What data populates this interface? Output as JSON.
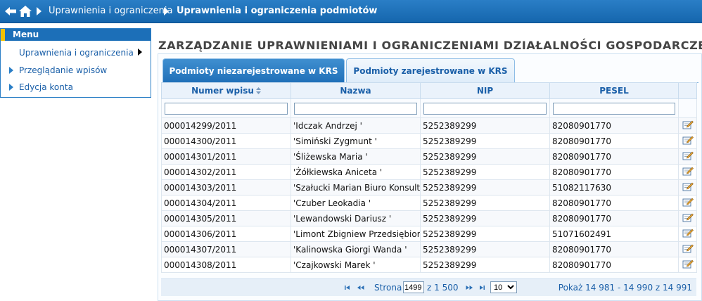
{
  "breadcrumb": {
    "item1": "Uprawnienia i ograniczenia",
    "item2": "Uprawnienia i ograniczenia podmiotów"
  },
  "menu": {
    "title": "Menu",
    "items": [
      {
        "label": "Uprawnienia i ograniczenia"
      },
      {
        "label": "Przeglądanie wpisów"
      },
      {
        "label": "Edycja konta"
      }
    ]
  },
  "page_title": "ZARZĄDZANIE UPRAWNIENIAMI I OGRANICZENIAMI DZIAŁALNOŚCI GOSPODARCZEJ",
  "tabs": [
    {
      "label": "Podmioty niezarejestrowane w KRS"
    },
    {
      "label": "Podmioty zarejestrowane w KRS"
    }
  ],
  "table": {
    "columns": [
      "Numer wpisu",
      "Nazwa",
      "NIP",
      "PESEL"
    ],
    "rows": [
      {
        "numer": "000014299/2011",
        "nazwa": "'Idczak Andrzej  '",
        "nip": "5252389299",
        "pesel": "82080901770"
      },
      {
        "numer": "000014300/2011",
        "nazwa": "'Simiński Zygmunt  '",
        "nip": "5252389299",
        "pesel": "82080901770"
      },
      {
        "numer": "000014301/2011",
        "nazwa": "'Śliżewska Maria  '",
        "nip": "5252389299",
        "pesel": "82080901770"
      },
      {
        "numer": "000014302/2011",
        "nazwa": "'Żółkiewska Aniceta  '",
        "nip": "5252389299",
        "pesel": "82080901770"
      },
      {
        "numer": "000014303/2011",
        "nazwa": "'Szałucki Marian Biuro Konsultin",
        "nip": "5252389299",
        "pesel": "51082117630"
      },
      {
        "numer": "000014304/2011",
        "nazwa": "'Czuber Leokadia  '",
        "nip": "5252389299",
        "pesel": "82080901770"
      },
      {
        "numer": "000014305/2011",
        "nazwa": "'Lewandowski Dariusz  '",
        "nip": "5252389299",
        "pesel": "82080901770"
      },
      {
        "numer": "000014306/2011",
        "nazwa": "'Limont Zbigniew Przedsiębiorst",
        "nip": "5252389299",
        "pesel": "51071602491"
      },
      {
        "numer": "000014307/2011",
        "nazwa": "'Kalinowska Giorgi Wanda  '",
        "nip": "5252389299",
        "pesel": "82080901770"
      },
      {
        "numer": "000014308/2011",
        "nazwa": "'Czajkowski Marek  '",
        "nip": "5252389299",
        "pesel": "82080901770"
      }
    ]
  },
  "pager": {
    "page_label": "Strona",
    "current_page": "1499",
    "of_label": "z 1 500",
    "rows_per_page": "10",
    "summary": "Pokaż 14 981 - 14 990 z 14 991"
  },
  "icons": {
    "back": "back-arrow-icon",
    "home": "home-icon",
    "edit": "edit-icon",
    "sort": "sort-icon"
  },
  "colors": {
    "topbar": "#1c6fb8",
    "menu_accent": "#f2c200",
    "tab_active": "#2a7ec6",
    "link": "#1a5fa8"
  }
}
